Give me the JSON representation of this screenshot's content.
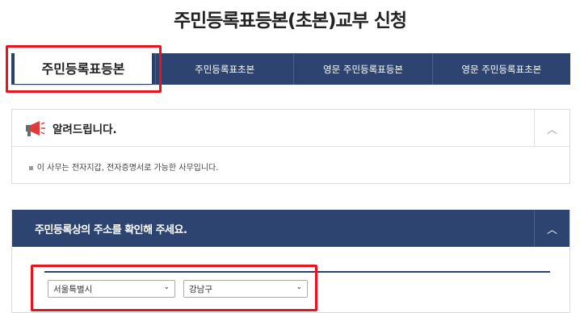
{
  "page": {
    "title": "주민등록표등본(초본)교부 신청"
  },
  "tabs": [
    {
      "label": "주민등록표등본",
      "active": true
    },
    {
      "label": "주민등록표초본",
      "active": false
    },
    {
      "label": "영문 주민등록표등본",
      "active": false
    },
    {
      "label": "영문 주민등록표초본",
      "active": false
    }
  ],
  "notice": {
    "title": "알려드립니다.",
    "toggle_icon": "chevron-up-icon",
    "message": "이 사무는 전자지갑, 전자증명서로 가능한 사무입니다."
  },
  "address": {
    "title": "주민등록상의 주소를 확인해 주세요.",
    "toggle_icon": "chevron-up-icon",
    "city_select": {
      "value": "서울특별시"
    },
    "district_select": {
      "value": "강남구"
    }
  },
  "colors": {
    "navy": "#2d4470",
    "highlight": "#e8131c"
  }
}
